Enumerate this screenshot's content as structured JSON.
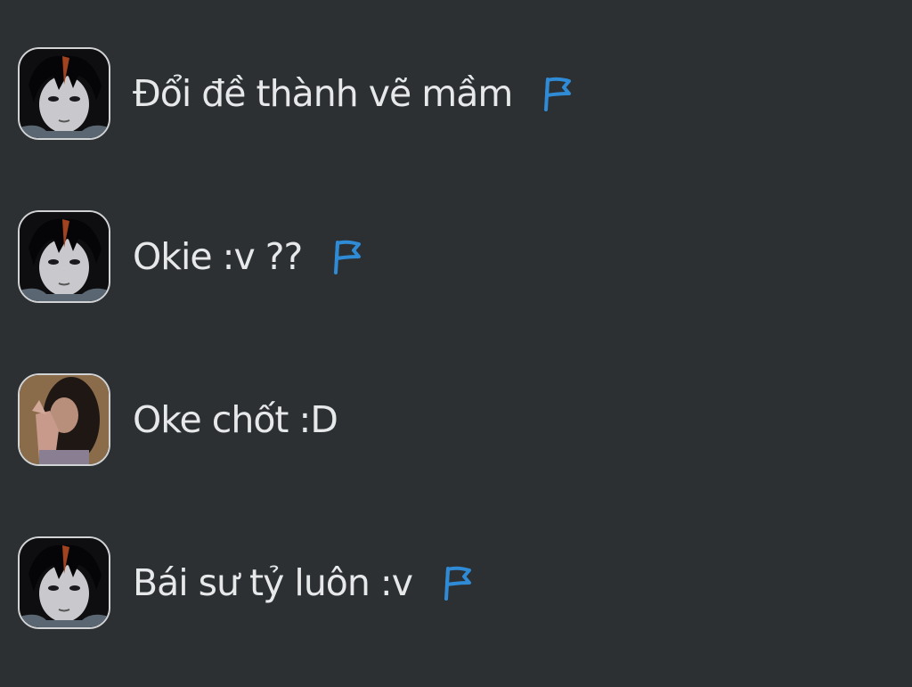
{
  "colors": {
    "background": "#2c3033",
    "message_text": "#e7e8e9",
    "flag_accent": "#2f8bd6",
    "avatar_border": "#d0d2d4"
  },
  "messages": [
    {
      "text": "Đổi đề thành vẽ mầm",
      "avatar": "dark-haired-avatar-icon",
      "flag": "flag-icon"
    },
    {
      "text": "Okie :v ??",
      "avatar": "dark-haired-avatar-icon",
      "flag": "flag-icon"
    },
    {
      "text": "Oke chốt :D",
      "avatar": "photo-avatar-icon",
      "flag": null
    },
    {
      "text": "Bái sư tỷ luôn :v",
      "avatar": "dark-haired-avatar-icon",
      "flag": "flag-icon"
    }
  ]
}
